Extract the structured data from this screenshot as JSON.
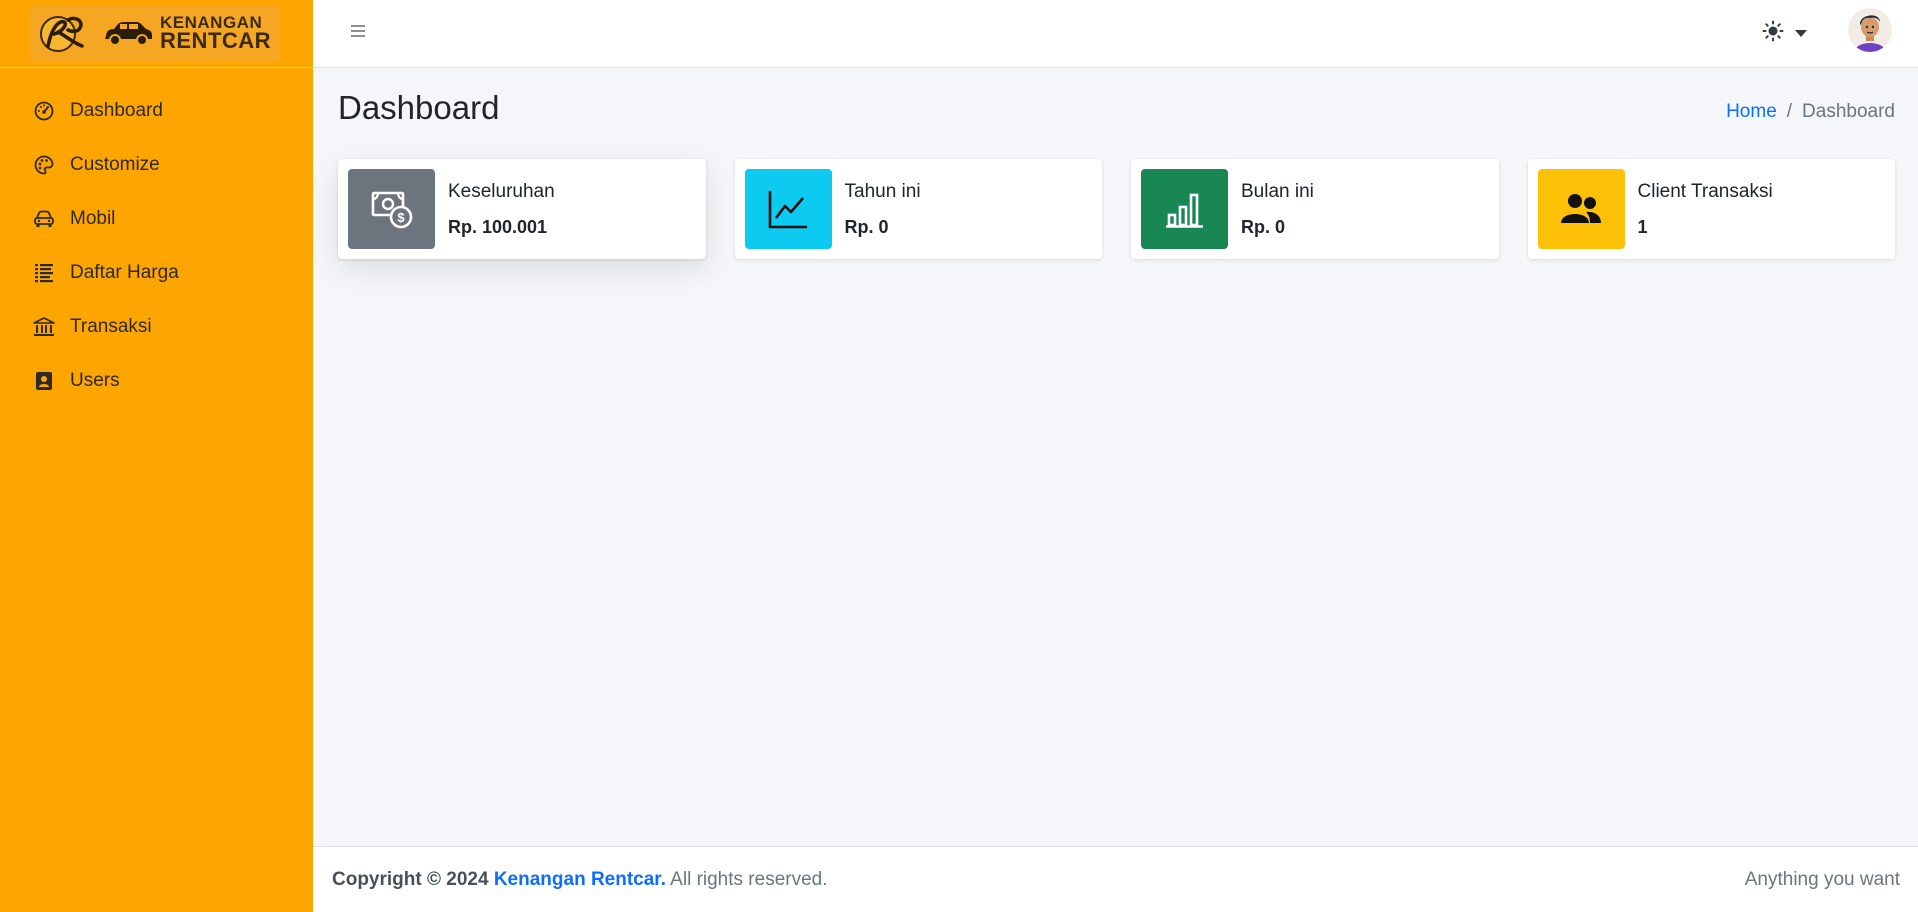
{
  "brand": {
    "line1": "KENANGAN",
    "line2": "RENTCAR",
    "logo_icon": "kr-monogram-logo",
    "car_icon": "car-logo-icon"
  },
  "sidebar": {
    "items": [
      {
        "label": "Dashboard",
        "icon": "speedometer-icon"
      },
      {
        "label": "Customize",
        "icon": "palette-icon"
      },
      {
        "label": "Mobil",
        "icon": "car-front-icon"
      },
      {
        "label": "Daftar Harga",
        "icon": "list-icon"
      },
      {
        "label": "Transaksi",
        "icon": "bank-icon"
      },
      {
        "label": "Users",
        "icon": "person-badge-icon"
      }
    ]
  },
  "topbar": {
    "menu_icon": "hamburger-icon",
    "theme_icon": "sun-icon",
    "caret_icon": "caret-down-icon",
    "avatar_icon": "user-avatar"
  },
  "page": {
    "title": "Dashboard",
    "breadcrumb": {
      "home": "Home",
      "separator": "/",
      "current": "Dashboard"
    }
  },
  "cards": [
    {
      "label": "Keseluruhan",
      "value": "Rp. 100.001",
      "icon": "cash-coin-icon",
      "color": "#6c757d"
    },
    {
      "label": "Tahun ini",
      "value": "Rp. 0",
      "icon": "graph-up-icon",
      "color": "#0dcaf0"
    },
    {
      "label": "Bulan ini",
      "value": "Rp. 0",
      "icon": "bar-chart-icon",
      "color": "#198754"
    },
    {
      "label": "Client Transaksi",
      "value": "1",
      "icon": "people-icon",
      "color": "#ffc107"
    }
  ],
  "footer": {
    "copyright": "Copyright © 2024",
    "brand": "Kenangan Rentcar.",
    "rights": "All rights reserved.",
    "right_text": "Anything you want"
  },
  "colors": {
    "sidebar": "#ffa500",
    "link": "#0d6efd",
    "background": "#f4f6f9"
  }
}
